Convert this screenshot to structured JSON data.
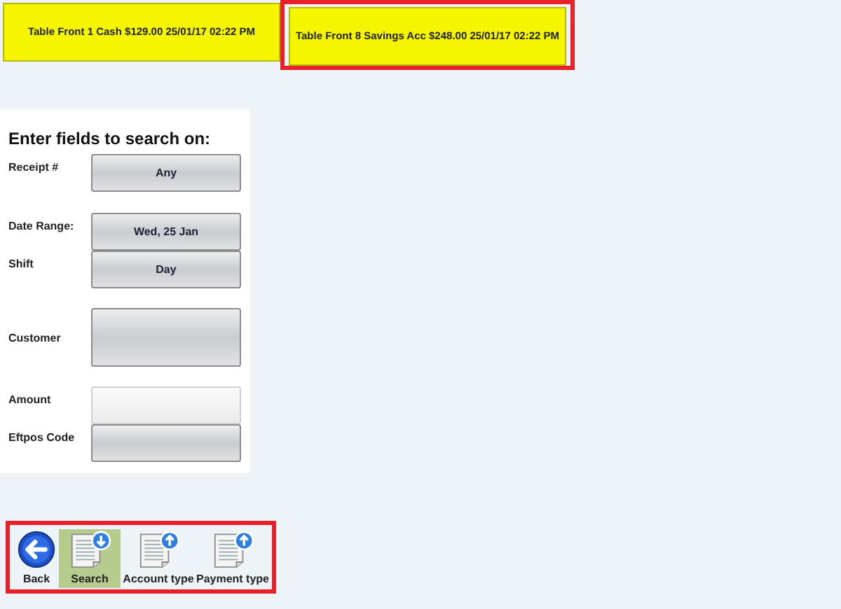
{
  "transactions": [
    {
      "label": "Table Front 1 Cash $129.00 25/01/17 02:22 PM",
      "highlighted": false
    },
    {
      "label": "Table Front 8 Savings Acc $248.00 25/01/17 02:22 PM",
      "highlighted": true
    }
  ],
  "search_panel": {
    "title": "Enter fields to search on:",
    "fields": [
      {
        "label": "Receipt #",
        "value": "Any",
        "disabled": false
      },
      {
        "label": "Date Range:",
        "value": "Wed, 25 Jan",
        "disabled": false
      },
      {
        "label": "Shift",
        "value": "Day",
        "disabled": false
      },
      {
        "label": "Customer",
        "disabled": false
      },
      {
        "label": "Amount",
        "disabled": true
      },
      {
        "label": "Eftpos Code",
        "disabled": false
      }
    ]
  },
  "toolbar": {
    "highlighted": true,
    "buttons": [
      {
        "label": "Back",
        "kind": "back",
        "selected": false
      },
      {
        "label": "Search",
        "kind": "down",
        "selected": true
      },
      {
        "label": "Account type",
        "kind": "up",
        "selected": false
      },
      {
        "label": "Payment type",
        "kind": "up",
        "selected": false
      }
    ]
  }
}
